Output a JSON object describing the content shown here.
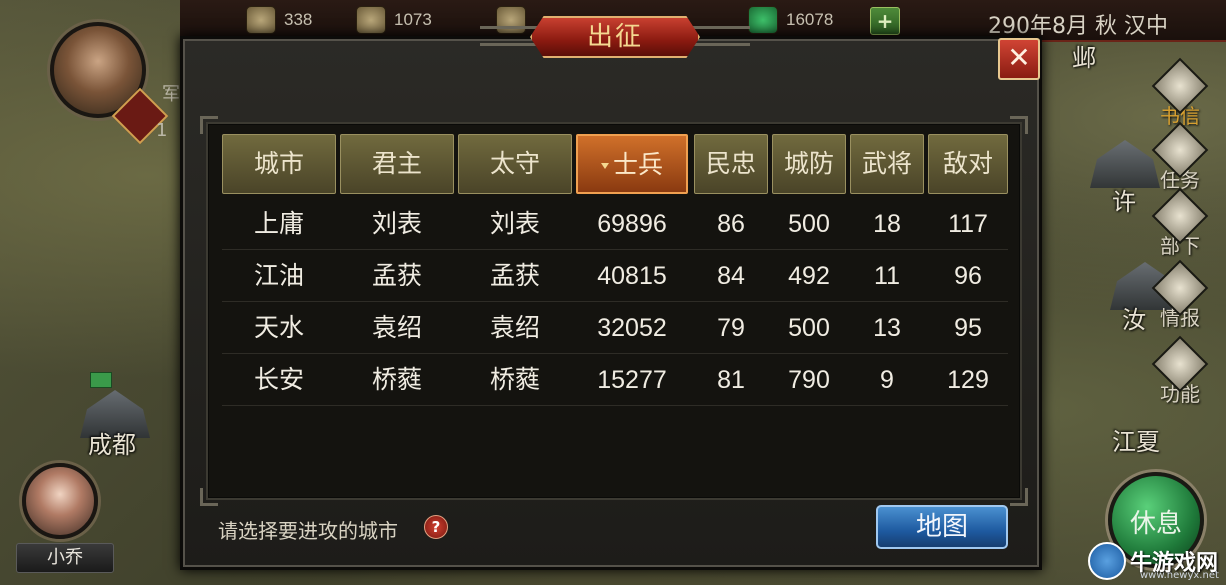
{
  "topbar": {
    "resources": [
      {
        "icon": "grain-sack-icon",
        "value": "338"
      },
      {
        "icon": "gold-coin-icon",
        "value": "1073"
      },
      {
        "icon": "gift-icon",
        "value": ""
      },
      {
        "icon": "jade-gem-icon",
        "value": "16078"
      }
    ],
    "add_label": "+",
    "date": "290年8月 秋 汉中"
  },
  "left": {
    "army_label": "军",
    "rank_num": "1",
    "companion_name": "小乔"
  },
  "map": {
    "labels": {
      "chengdu": "成都",
      "xu": "许",
      "ru": "汝",
      "ye": "邺",
      "jiang": "江夏"
    }
  },
  "side_menu": {
    "mail": "书信",
    "tasks": "任务",
    "subordinates": "部下",
    "intel": "情报",
    "functions": "功能",
    "rest": "休息"
  },
  "dialog": {
    "title": "出征",
    "close": "✕",
    "columns": [
      "城市",
      "君主",
      "太守",
      "士兵",
      "民忠",
      "城防",
      "武将",
      "敌对"
    ],
    "sorted_column": "士兵",
    "rows": [
      [
        "上庸",
        "刘表",
        "刘表",
        "69896",
        "86",
        "500",
        "18",
        "117"
      ],
      [
        "江油",
        "孟获",
        "孟获",
        "40815",
        "84",
        "492",
        "11",
        "96"
      ],
      [
        "天水",
        "袁绍",
        "袁绍",
        "32052",
        "79",
        "500",
        "13",
        "95"
      ],
      [
        "长安",
        "桥蕤",
        "桥蕤",
        "15277",
        "81",
        "790",
        "9",
        "129"
      ]
    ],
    "hint": "请选择要进攻的城市",
    "help": "?",
    "map_button": "地图"
  },
  "watermark": {
    "text": "牛游戏网",
    "url": "www.newyx.net"
  },
  "colors": {
    "header_gold": "#716a3e",
    "active_orange": "#d0702a",
    "title_red": "#c84030",
    "map_btn_blue": "#1e5aa0"
  }
}
